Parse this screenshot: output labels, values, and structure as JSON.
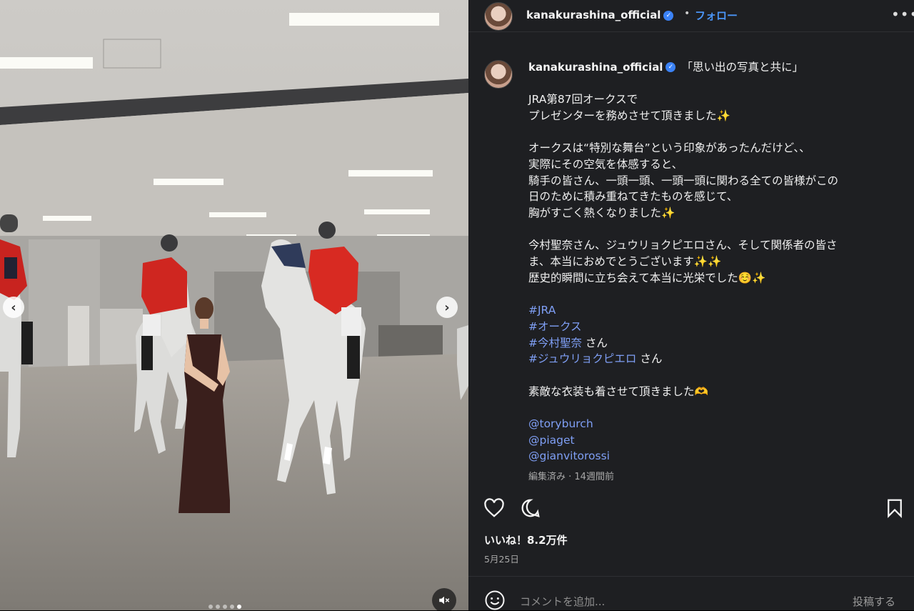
{
  "post": {
    "username": "kanakurashina_official",
    "follow_label": "フォロー",
    "separator": "•",
    "more_label": "•••"
  },
  "caption": {
    "title": "「思い出の写真と共に」",
    "lines": [
      "JRA第87回オークスで",
      "プレゼンターを務めさせて頂きました✨",
      "",
      "オークスは“特別な舞台”という印象があったんだけど、、",
      "実際にその空気を体感すると、",
      "騎手の皆さん、一頭一頭、一頭一頭に関わる全ての皆様がこの",
      "日のために積み重ねてきたものを感じて、",
      "胸がすごく熱くなりました✨",
      "",
      "今村聖奈さん、ジュウリョクピエロさん、そして関係者の皆さ",
      "ま、本当におめでとうございます✨✨",
      "歴史的瞬間に立ち会えて本当に光栄でした☺️✨",
      ""
    ],
    "hashtags": [
      {
        "tag": "#JRA",
        "suffix": ""
      },
      {
        "tag": "#オークス",
        "suffix": ""
      },
      {
        "tag": "#今村聖奈",
        "suffix": " さん"
      },
      {
        "tag": "#ジュウリョクピエロ",
        "suffix": " さん"
      }
    ],
    "after_tags": "素敵な衣装も着させて頂きました🫶",
    "mentions": [
      "@toryburch",
      "@piaget",
      "@gianvitorossi"
    ],
    "meta": "編集済み · 14週間前"
  },
  "engagement": {
    "likes": "いいね！8.2万件",
    "date": "5月25日"
  },
  "comment": {
    "placeholder": "コメントを追加...",
    "post_label": "投稿する"
  },
  "media": {
    "prev_label": "‹",
    "next_label": "›",
    "slide_count": 5,
    "active_slide": 4
  },
  "colors": {
    "panel_bg": "#1e1f22",
    "link": "#7f9ff5",
    "follow": "#4a94f5",
    "verified": "#3b82f6"
  }
}
